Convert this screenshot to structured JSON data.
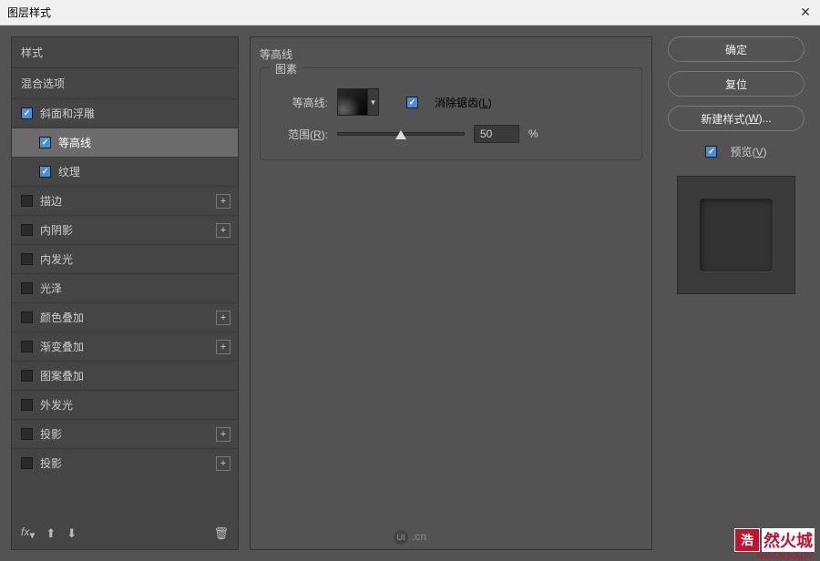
{
  "titlebar": {
    "title": "图层样式"
  },
  "leftPanel": {
    "styleHeader": "样式",
    "blendHeader": "混合选项",
    "items": [
      {
        "label": "斜面和浮雕",
        "checked": true,
        "indented": false,
        "hasPlus": false,
        "selected": false
      },
      {
        "label": "等高线",
        "checked": true,
        "indented": true,
        "hasPlus": false,
        "selected": true
      },
      {
        "label": "纹理",
        "checked": true,
        "indented": true,
        "hasPlus": false,
        "selected": false
      },
      {
        "label": "描边",
        "checked": false,
        "indented": false,
        "hasPlus": true,
        "selected": false
      },
      {
        "label": "内阴影",
        "checked": false,
        "indented": false,
        "hasPlus": true,
        "selected": false
      },
      {
        "label": "内发光",
        "checked": false,
        "indented": false,
        "hasPlus": false,
        "selected": false
      },
      {
        "label": "光泽",
        "checked": false,
        "indented": false,
        "hasPlus": false,
        "selected": false
      },
      {
        "label": "颜色叠加",
        "checked": false,
        "indented": false,
        "hasPlus": true,
        "selected": false
      },
      {
        "label": "渐变叠加",
        "checked": false,
        "indented": false,
        "hasPlus": true,
        "selected": false
      },
      {
        "label": "图案叠加",
        "checked": false,
        "indented": false,
        "hasPlus": false,
        "selected": false
      },
      {
        "label": "外发光",
        "checked": false,
        "indented": false,
        "hasPlus": false,
        "selected": false
      },
      {
        "label": "投影",
        "checked": false,
        "indented": false,
        "hasPlus": true,
        "selected": false
      },
      {
        "label": "投影",
        "checked": false,
        "indented": false,
        "hasPlus": true,
        "selected": false
      }
    ],
    "footer": {
      "fx": "fx"
    }
  },
  "centerPanel": {
    "title": "等高线",
    "fieldsetLegend": "图素",
    "contourLabel": "等高线:",
    "antialiasLabel": "消除锯齿(L)",
    "antialiasChecked": true,
    "rangeLabel": "范围(R):",
    "rangeValue": "50",
    "rangeUnit": "%"
  },
  "rightPanel": {
    "okBtn": "确定",
    "resetBtn": "复位",
    "newStyleBtn": "新建样式(W)...",
    "previewLabel": "预览(V)",
    "previewChecked": true
  },
  "watermark": {
    "badge": "浩",
    "text": "然火城",
    "url": "www.hryckj.cn"
  },
  "centerLogo": {
    "text": ".cn"
  }
}
